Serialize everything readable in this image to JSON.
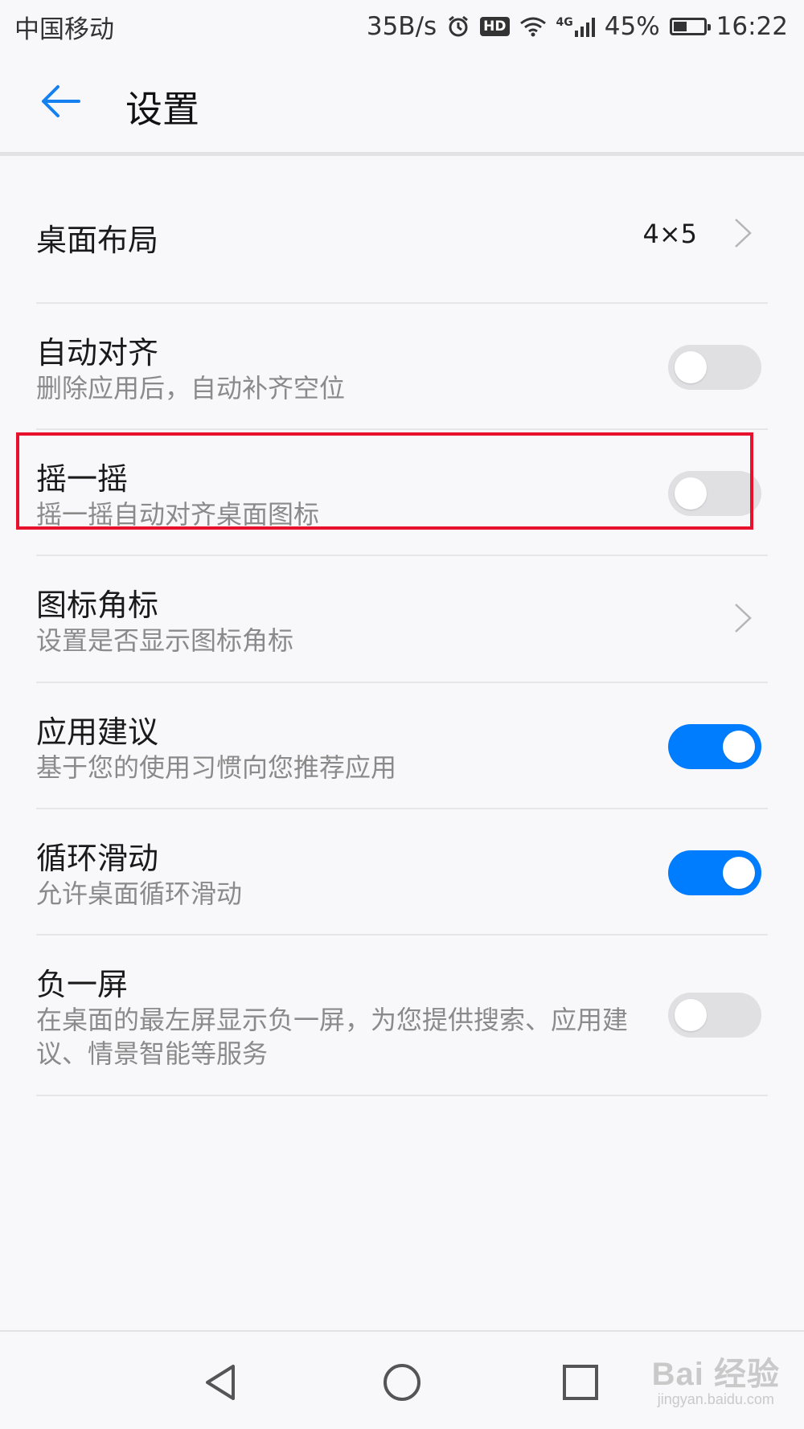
{
  "status_bar": {
    "carrier": "中国移动",
    "net_speed": "35B/s",
    "hd": "HD",
    "network": "4G",
    "battery": "45%",
    "battery_level": 0.45,
    "time": "16:22"
  },
  "header": {
    "title": "设置"
  },
  "settings": [
    {
      "title": "桌面布局",
      "value": "4×5",
      "control": "chevron"
    },
    {
      "title": "自动对齐",
      "subtitle": "删除应用后，自动补齐空位",
      "control": "toggle",
      "on": false
    },
    {
      "title": "摇一摇",
      "subtitle": "摇一摇自动对齐桌面图标",
      "control": "toggle",
      "on": false,
      "highlighted": true
    },
    {
      "title": "图标角标",
      "subtitle": "设置是否显示图标角标",
      "control": "chevron"
    },
    {
      "title": "应用建议",
      "subtitle": "基于您的使用习惯向您推荐应用",
      "control": "toggle",
      "on": true
    },
    {
      "title": "循环滑动",
      "subtitle": "允许桌面循环滑动",
      "control": "toggle",
      "on": true
    },
    {
      "title": "负一屏",
      "subtitle": "在桌面的最左屏显示负一屏，为您提供搜索、应用建议、情景智能等服务",
      "control": "toggle",
      "on": false
    }
  ],
  "watermark": {
    "main": "Bai 经验",
    "sub": "jingyan.baidu.com"
  },
  "colors": {
    "accent": "#007dff",
    "highlight": "#e8112d"
  }
}
